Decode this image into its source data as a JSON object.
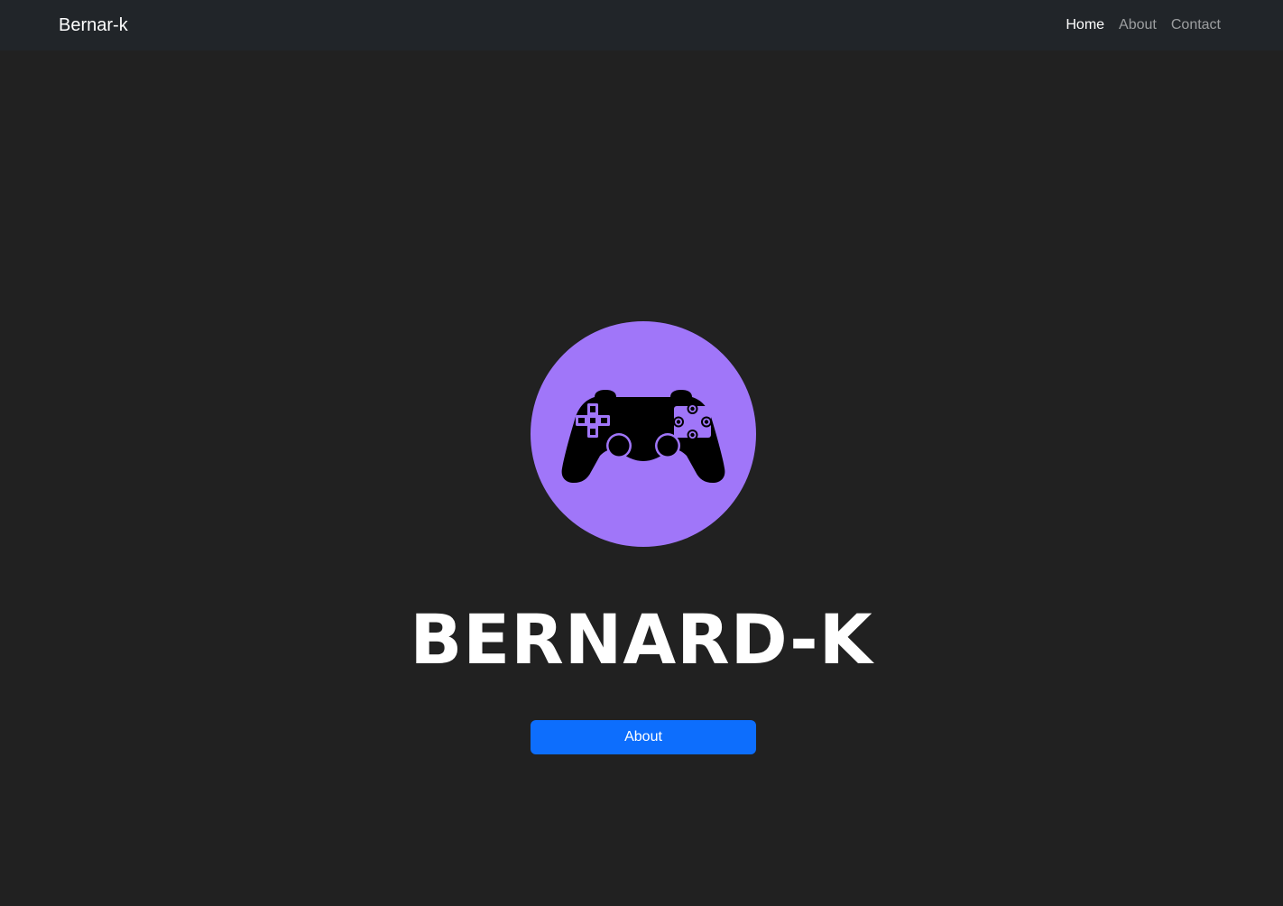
{
  "navbar": {
    "brand": "Bernar-k",
    "links": [
      {
        "label": "Home",
        "active": true
      },
      {
        "label": "About",
        "active": false
      },
      {
        "label": "Contact",
        "active": false
      }
    ]
  },
  "hero": {
    "avatar_icon": "gamepad-icon",
    "avatar_color": "#a076f9",
    "title": "BERNARD-K",
    "button_label": "About",
    "button_color": "#0d6efd"
  },
  "colors": {
    "page_background": "#212121",
    "navbar_background": "#212529"
  }
}
